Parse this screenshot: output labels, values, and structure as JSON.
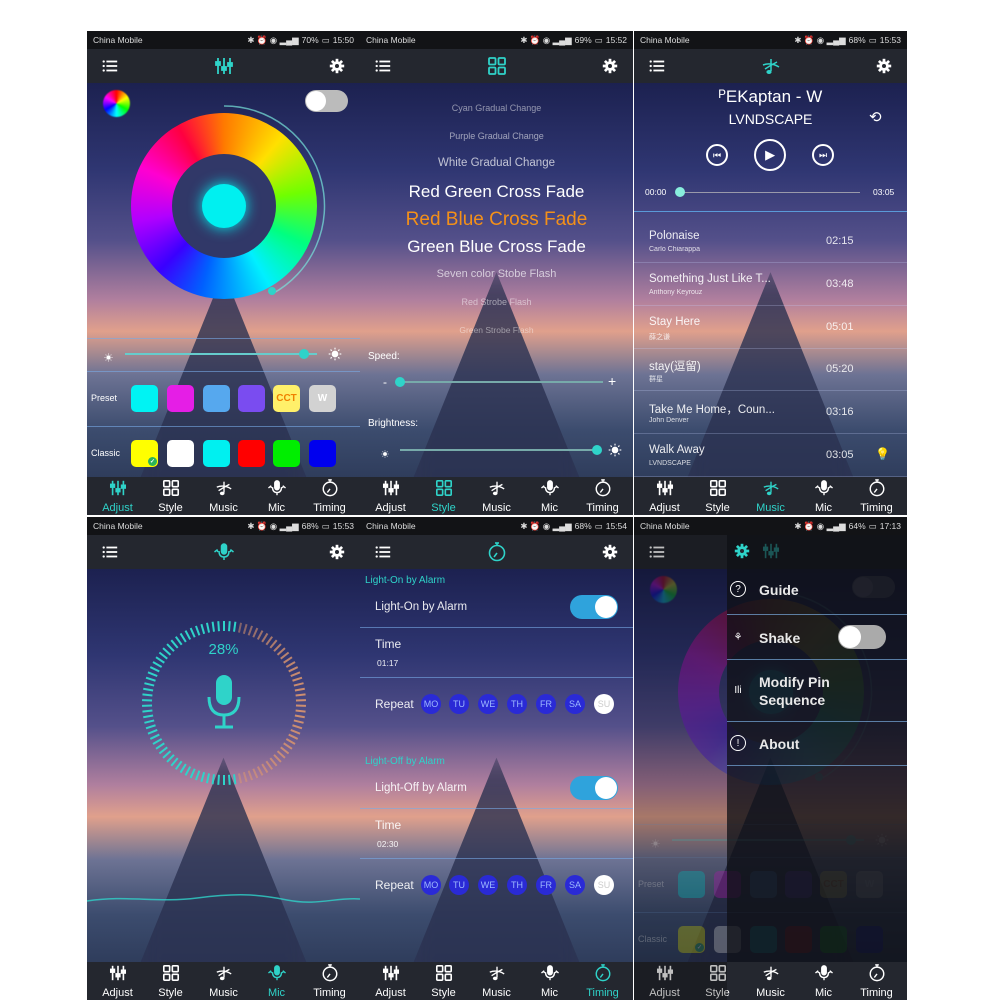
{
  "accent": "#2fd3c9",
  "status_bars": [
    {
      "carrier": "China Mobile",
      "battery": "70%",
      "time": "15:50"
    },
    {
      "carrier": "China Mobile",
      "battery": "69%",
      "time": "15:52"
    },
    {
      "carrier": "China Mobile",
      "battery": "68%",
      "time": "15:53"
    },
    {
      "carrier": "China Mobile",
      "battery": "68%",
      "time": "15:53"
    },
    {
      "carrier": "China Mobile",
      "battery": "68%",
      "time": "15:54"
    },
    {
      "carrier": "China Mobile",
      "battery": "64%",
      "time": "17:13"
    }
  ],
  "tabs": [
    "Adjust",
    "Style",
    "Music",
    "Mic",
    "Timing"
  ],
  "adjust": {
    "power_on": false,
    "brightness": 0.93,
    "preset_label": "Preset",
    "classic_label": "Classic",
    "preset": [
      {
        "color": "#00f3f3"
      },
      {
        "color": "#e51ee6"
      },
      {
        "color": "#56a8ee"
      },
      {
        "color": "#7a4cf0"
      },
      {
        "color": "#fff06a",
        "label": "CCT"
      },
      {
        "color": "#d2d2d2",
        "label": "W"
      }
    ],
    "classic": [
      {
        "color": "#ffff00",
        "selected": true
      },
      {
        "color": "#ffffff"
      },
      {
        "color": "#00f0f0"
      },
      {
        "color": "#ff0000"
      },
      {
        "color": "#00ee00"
      },
      {
        "color": "#0000ee"
      }
    ],
    "selected_color": "#00f0f0"
  },
  "style": {
    "modes": [
      "Cyan Gradual Change",
      "Purple Gradual Change",
      "White Gradual Change",
      "Red Green Cross Fade",
      "Red Blue Cross Fade",
      "Green Blue Cross Fade",
      "Seven color Stobe Flash",
      "Red Strobe Flash",
      "Green Strobe Flash"
    ],
    "selected_index": 4,
    "speed_label": "Speed:",
    "brightness_label": "Brightness:",
    "minus": "-",
    "plus": "+",
    "speed": 0,
    "brightness": 1
  },
  "music": {
    "now_playing_title": "ᴾEKaptan - W",
    "now_playing_artist": "LVNDSCAPE",
    "elapsed": "00:00",
    "duration": "03:05",
    "progress": 0,
    "tracks": [
      {
        "title": "Polonaise",
        "artist": "Carlo Chiarappa",
        "duration": "02:15"
      },
      {
        "title": "Something Just Like T...",
        "artist": "Anthony Keyrouz",
        "duration": "03:48"
      },
      {
        "title": "Stay Here",
        "artist": "薛之谦",
        "duration": "05:01"
      },
      {
        "title": "stay(逗留)",
        "artist": "群星",
        "duration": "05:20"
      },
      {
        "title": "Take Me Home，Coun...",
        "artist": "John Denver",
        "duration": "03:16"
      },
      {
        "title": "Walk Away",
        "artist": "LVNDSCAPE",
        "duration": "03:05",
        "playing": true
      }
    ]
  },
  "mic": {
    "level": "28%"
  },
  "timing": {
    "on": {
      "section": "Light-On by Alarm",
      "label": "Light-On by Alarm",
      "enabled": true,
      "time_label": "Time",
      "time": "01:17",
      "repeat_label": "Repeat"
    },
    "off": {
      "section": "Light-Off by Alarm",
      "label": "Light-Off by Alarm",
      "enabled": true,
      "time_label": "Time",
      "time": "02:30",
      "repeat_label": "Repeat"
    },
    "days": [
      {
        "label": "MO",
        "on": true
      },
      {
        "label": "TU",
        "on": true
      },
      {
        "label": "WE",
        "on": true
      },
      {
        "label": "TH",
        "on": true
      },
      {
        "label": "FR",
        "on": true
      },
      {
        "label": "SA",
        "on": true
      },
      {
        "label": "SU",
        "on": false
      }
    ]
  },
  "menu": {
    "items": [
      {
        "label": "Guide",
        "icon": "question-icon"
      },
      {
        "label": "Shake",
        "icon": "shake-icon",
        "toggle": false
      },
      {
        "label": "Modify Pin Sequence",
        "icon": "pin-sequence-icon"
      },
      {
        "label": "About",
        "icon": "info-icon"
      }
    ]
  }
}
